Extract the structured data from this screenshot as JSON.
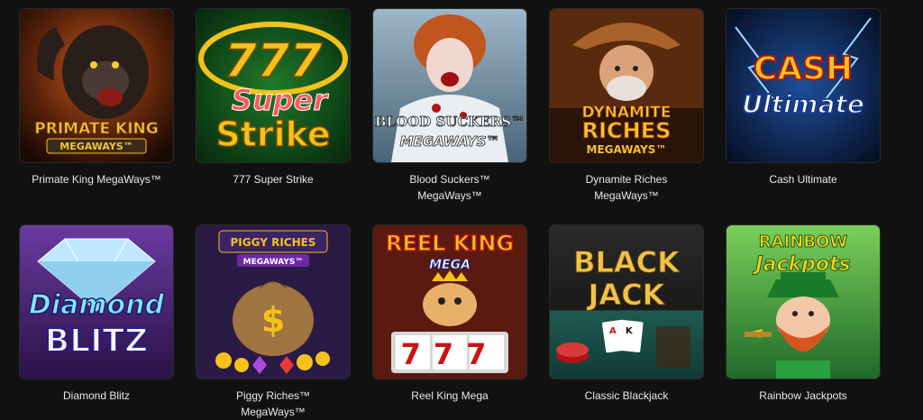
{
  "games": [
    {
      "name": "Primate King MegaWays™",
      "art_line1": "PRIMATE KING",
      "art_line2": "MEGAWAYS™",
      "bg": "#3a1a0a",
      "accent": "#f4c430"
    },
    {
      "name": "777 Super Strike",
      "art_line1": "777",
      "art_line2": "Super",
      "art_line3": "Strike",
      "bg": "#0f4a18",
      "accent": "#f5c21b"
    },
    {
      "name": "Blood Suckers™ MegaWays™",
      "name_line1": "Blood Suckers™",
      "name_line2": "MegaWays™",
      "art_line1": "BLOOD SUCKERS™",
      "art_line2": "MEGAWAYS™",
      "bg": "#6e8fa8",
      "accent": "#ffffff"
    },
    {
      "name": "Dynamite Riches MegaWays™",
      "name_line1": "Dynamite Riches",
      "name_line2": "MegaWays™",
      "art_line1": "DYNAMITE",
      "art_line2": "RICHES",
      "art_line3": "MEGAWAYS™",
      "bg": "#5a2a0e",
      "accent": "#f6c12a"
    },
    {
      "name": "Cash Ultimate",
      "art_line1": "CASH",
      "art_line2": "Ultimate",
      "bg": "#0b1a3a",
      "accent": "#f5c21b"
    },
    {
      "name": "Diamond Blitz",
      "art_line1": "Diamond",
      "art_line2": "BLITZ",
      "bg": "#5c2f8f",
      "accent": "#7fe8ff"
    },
    {
      "name": "Piggy Riches™ MegaWays™",
      "art_line1": "PIGGY RICHES",
      "art_line2": "MEGAWAYS™",
      "bg": "#2a1a46",
      "accent": "#f5c21b"
    },
    {
      "name": "Reel King Mega",
      "art_line1": "REEL KING",
      "art_line2": "MEGA",
      "art_line3": "777",
      "bg": "#5a1a10",
      "accent": "#f5c21b"
    },
    {
      "name": "Classic Blackjack",
      "art_line1": "BLACK",
      "art_line2": "JACK",
      "bg": "#1c3d3a",
      "accent": "#f0c24a"
    },
    {
      "name": "Rainbow Jackpots",
      "art_line1": "RAINBOW",
      "art_line2": "Jackpots",
      "bg": "#2f8f3a",
      "accent": "#f5d21b"
    }
  ]
}
